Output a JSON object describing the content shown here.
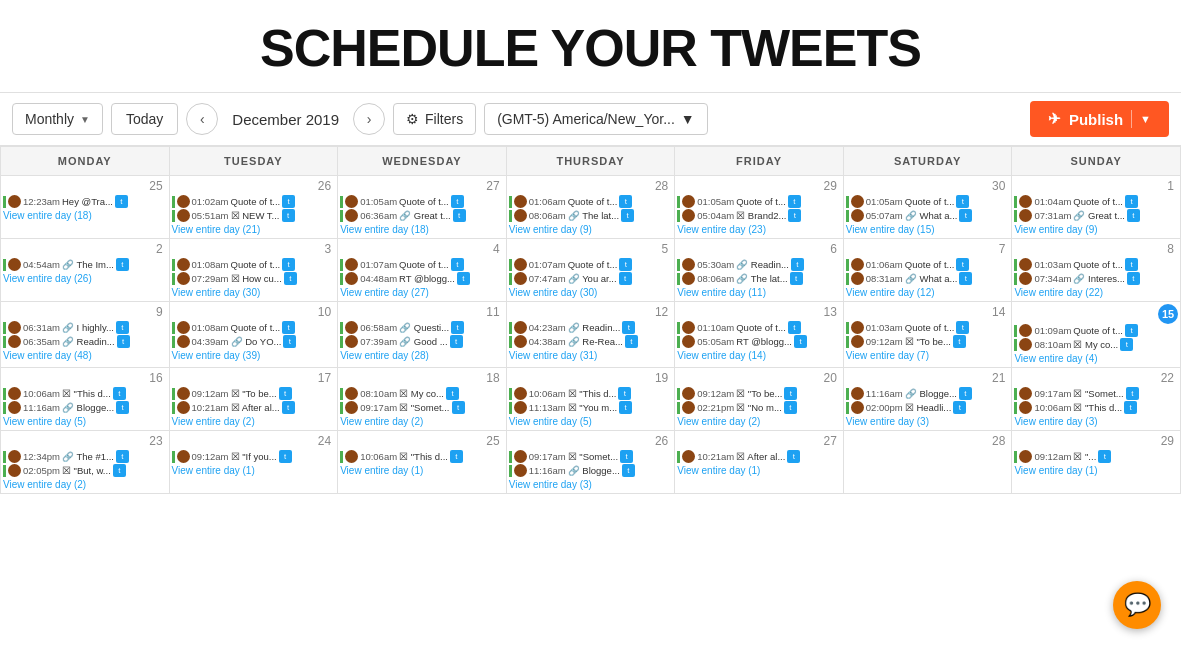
{
  "title": "SCHEDULE YOUR TWEETS",
  "toolbar": {
    "monthly_label": "Monthly",
    "today_label": "Today",
    "date_label": "December 2019",
    "filters_label": "Filters",
    "timezone_label": "(GMT-5) America/New_Yor...",
    "publish_label": "Publish"
  },
  "calendar": {
    "days": [
      "MONDAY",
      "TUESDAY",
      "WEDNESDAY",
      "THURSDAY",
      "FRIDAY",
      "SATURDAY",
      "SUNDAY"
    ],
    "weeks": [
      {
        "cells": [
          {
            "num": "25",
            "tweets": [
              {
                "time": "12:23am",
                "text": "Hey @Tra...",
                "count": 18
              }
            ],
            "view": "View entire day (18)"
          },
          {
            "num": "26",
            "tweets": [
              {
                "time": "01:02am",
                "text": "Quote of t..."
              },
              {
                "time": "05:51am",
                "text": "☒ NEW T..."
              }
            ],
            "view": "View entire day (21)"
          },
          {
            "num": "27",
            "tweets": [
              {
                "time": "01:05am",
                "text": "Quote of t..."
              },
              {
                "time": "06:36am",
                "text": "🔗 Great t..."
              }
            ],
            "view": "View entire day (18)"
          },
          {
            "num": "28",
            "tweets": [
              {
                "time": "01:06am",
                "text": "Quote of t..."
              },
              {
                "time": "08:06am",
                "text": "🔗 The lat..."
              }
            ],
            "view": "View entire day (9)"
          },
          {
            "num": "29",
            "tweets": [
              {
                "time": "01:05am",
                "text": "Quote of t..."
              },
              {
                "time": "05:04am",
                "text": "☒ Brand2..."
              }
            ],
            "view": "View entire day (23)"
          },
          {
            "num": "30",
            "tweets": [
              {
                "time": "01:05am",
                "text": "Quote of t..."
              },
              {
                "time": "05:07am",
                "text": "🔗 What a..."
              }
            ],
            "view": "View entire day (15)"
          },
          {
            "num": "1",
            "tweets": [
              {
                "time": "01:04am",
                "text": "Quote of t..."
              },
              {
                "time": "07:31am",
                "text": "🔗 Great t..."
              }
            ],
            "view": "View entire day (9)"
          }
        ]
      },
      {
        "cells": [
          {
            "num": "2",
            "tweets": [
              {
                "time": "04:54am",
                "text": "🔗 The Im..."
              }
            ],
            "view": "View entire day (26)"
          },
          {
            "num": "3",
            "tweets": [
              {
                "time": "01:08am",
                "text": "Quote of t..."
              },
              {
                "time": "07:29am",
                "text": "☒ How cu..."
              }
            ],
            "view": "View entire day (30)"
          },
          {
            "num": "4",
            "tweets": [
              {
                "time": "01:07am",
                "text": "Quote of t..."
              },
              {
                "time": "04:48am",
                "text": "RT @blogg..."
              }
            ],
            "view": "View entire day (27)"
          },
          {
            "num": "5",
            "tweets": [
              {
                "time": "01:07am",
                "text": "Quote of t..."
              },
              {
                "time": "07:47am",
                "text": "🔗 You ar..."
              }
            ],
            "view": "View entire day (30)"
          },
          {
            "num": "6",
            "tweets": [
              {
                "time": "05:30am",
                "text": "🔗 Readin..."
              },
              {
                "time": "08:06am",
                "text": "🔗 The lat..."
              }
            ],
            "view": "View entire day (11)"
          },
          {
            "num": "7",
            "tweets": [
              {
                "time": "01:06am",
                "text": "Quote of t..."
              },
              {
                "time": "08:31am",
                "text": "🔗 What a..."
              }
            ],
            "view": "View entire day (12)"
          },
          {
            "num": "8",
            "tweets": [
              {
                "time": "01:03am",
                "text": "Quote of t..."
              },
              {
                "time": "07:34am",
                "text": "🔗 Interes..."
              }
            ],
            "view": "View entire day (22)"
          }
        ]
      },
      {
        "cells": [
          {
            "num": "9",
            "tweets": [
              {
                "time": "06:31am",
                "text": "🔗 I highly..."
              },
              {
                "time": "06:35am",
                "text": "🔗 Readin..."
              }
            ],
            "view": "View entire day (48)"
          },
          {
            "num": "10",
            "tweets": [
              {
                "time": "01:08am",
                "text": "Quote of t..."
              },
              {
                "time": "04:39am",
                "text": "🔗 Do YO..."
              }
            ],
            "view": "View entire day (39)"
          },
          {
            "num": "11",
            "tweets": [
              {
                "time": "06:58am",
                "text": "🔗 Questi..."
              },
              {
                "time": "07:39am",
                "text": "🔗 Good ..."
              }
            ],
            "view": "View entire day (28)"
          },
          {
            "num": "12",
            "tweets": [
              {
                "time": "04:23am",
                "text": "🔗 Readin..."
              },
              {
                "time": "04:38am",
                "text": "🔗 Re-Rea..."
              }
            ],
            "view": "View entire day (31)"
          },
          {
            "num": "13",
            "tweets": [
              {
                "time": "01:10am",
                "text": "Quote of t..."
              },
              {
                "time": "05:05am",
                "text": "RT @blogg..."
              }
            ],
            "view": "View entire day (14)"
          },
          {
            "num": "14",
            "tweets": [
              {
                "time": "01:03am",
                "text": "Quote of t..."
              },
              {
                "time": "09:12am",
                "text": "☒ \"To be..."
              }
            ],
            "view": "View entire day (7)"
          },
          {
            "num": "15",
            "today": true,
            "tweets": [
              {
                "time": "01:09am",
                "text": "Quote of t..."
              },
              {
                "time": "08:10am",
                "text": "☒ My co..."
              }
            ],
            "view": "View entire day (4)"
          }
        ]
      },
      {
        "cells": [
          {
            "num": "16",
            "tweets": [
              {
                "time": "10:06am",
                "text": "☒ \"This d..."
              },
              {
                "time": "11:16am",
                "text": "🔗 Blogge..."
              }
            ],
            "view": "View entire day (5)"
          },
          {
            "num": "17",
            "tweets": [
              {
                "time": "09:12am",
                "text": "☒ \"To be..."
              },
              {
                "time": "10:21am",
                "text": "☒ After al..."
              }
            ],
            "view": "View entire day (2)"
          },
          {
            "num": "18",
            "tweets": [
              {
                "time": "08:10am",
                "text": "☒ My co..."
              },
              {
                "time": "09:17am",
                "text": "☒ \"Somet..."
              }
            ],
            "view": "View entire day (2)"
          },
          {
            "num": "19",
            "tweets": [
              {
                "time": "10:06am",
                "text": "☒ \"This d..."
              },
              {
                "time": "11:13am",
                "text": "☒ \"You m..."
              }
            ],
            "view": "View entire day (5)"
          },
          {
            "num": "20",
            "tweets": [
              {
                "time": "09:12am",
                "text": "☒ \"To be..."
              },
              {
                "time": "02:21pm",
                "text": "☒ \"No m..."
              }
            ],
            "view": "View entire day (2)"
          },
          {
            "num": "21",
            "tweets": [
              {
                "time": "11:16am",
                "text": "🔗 Blogge..."
              },
              {
                "time": "02:00pm",
                "text": "☒ Headli..."
              }
            ],
            "view": "View entire day (3)"
          },
          {
            "num": "22",
            "tweets": [
              {
                "time": "09:17am",
                "text": "☒ \"Somet..."
              },
              {
                "time": "10:06am",
                "text": "☒ \"This d..."
              }
            ],
            "view": "View entire day (3)"
          }
        ]
      },
      {
        "cells": [
          {
            "num": "23",
            "tweets": [
              {
                "time": "12:34pm",
                "text": "🔗 The #1..."
              },
              {
                "time": "02:05pm",
                "text": "☒ \"But, w..."
              }
            ],
            "view": "View entire day (2)"
          },
          {
            "num": "24",
            "tweets": [
              {
                "time": "09:12am",
                "text": "☒ \"If you..."
              }
            ],
            "view": "View entire day (1)"
          },
          {
            "num": "25",
            "tweets": [
              {
                "time": "10:06am",
                "text": "☒ \"This d..."
              }
            ],
            "view": "View entire day (1)"
          },
          {
            "num": "26",
            "tweets": [
              {
                "time": "09:17am",
                "text": "☒ \"Somet..."
              },
              {
                "time": "11:16am",
                "text": "🔗 Blogge..."
              }
            ],
            "view": "View entire day (3)"
          },
          {
            "num": "27",
            "tweets": [
              {
                "time": "10:21am",
                "text": "☒ After al..."
              }
            ],
            "view": "View entire day (1)"
          },
          {
            "num": "28",
            "tweets": [],
            "view": ""
          },
          {
            "num": "29",
            "tweets": [
              {
                "time": "09:12am",
                "text": "☒ \"..."
              }
            ],
            "view": "View entire day (1)"
          }
        ]
      }
    ]
  }
}
